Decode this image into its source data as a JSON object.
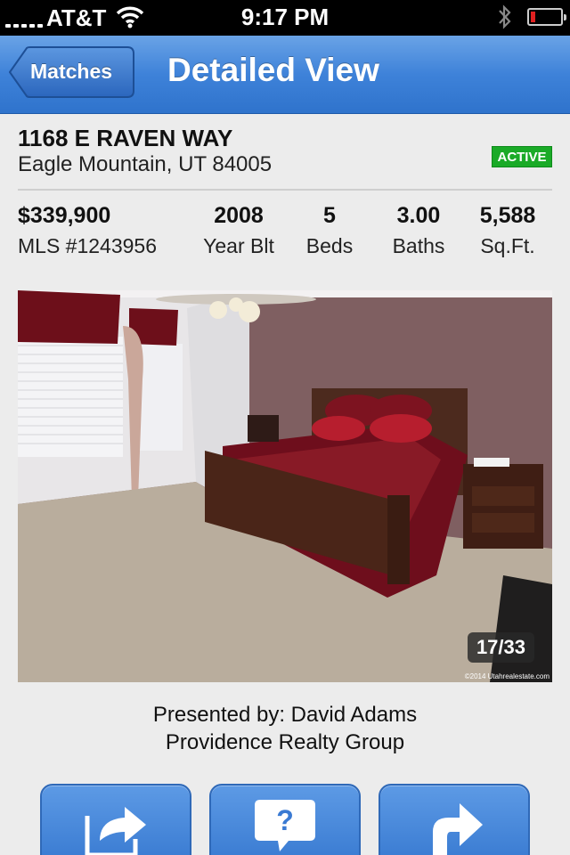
{
  "status_bar": {
    "carrier": "AT&T",
    "time": "9:17 PM"
  },
  "nav": {
    "back_label": "Matches",
    "title": "Detailed View"
  },
  "listing": {
    "address": "1168 E RAVEN WAY",
    "city": "Eagle Mountain, UT 84005",
    "status": "ACTIVE",
    "status_color": "#1aaa27",
    "price": "$339,900",
    "mls": "MLS #1243956",
    "year_value": "2008",
    "year_label": "Year Blt",
    "beds_value": "5",
    "beds_label": "Beds",
    "baths_value": "3.00",
    "baths_label": "Baths",
    "sqft_value": "5,588",
    "sqft_label": "Sq.Ft."
  },
  "photo": {
    "counter": "17/33",
    "watermark": "©2014 Utahrealestate.com"
  },
  "presenter": {
    "line1": "Presented by: David Adams",
    "line2": "Providence Realty Group"
  },
  "actions": [
    {
      "icon": "share-icon"
    },
    {
      "icon": "question-icon"
    },
    {
      "icon": "directions-icon"
    }
  ],
  "colors": {
    "nav_blue": "#3e82d9",
    "button_blue": "#4a89dc"
  }
}
